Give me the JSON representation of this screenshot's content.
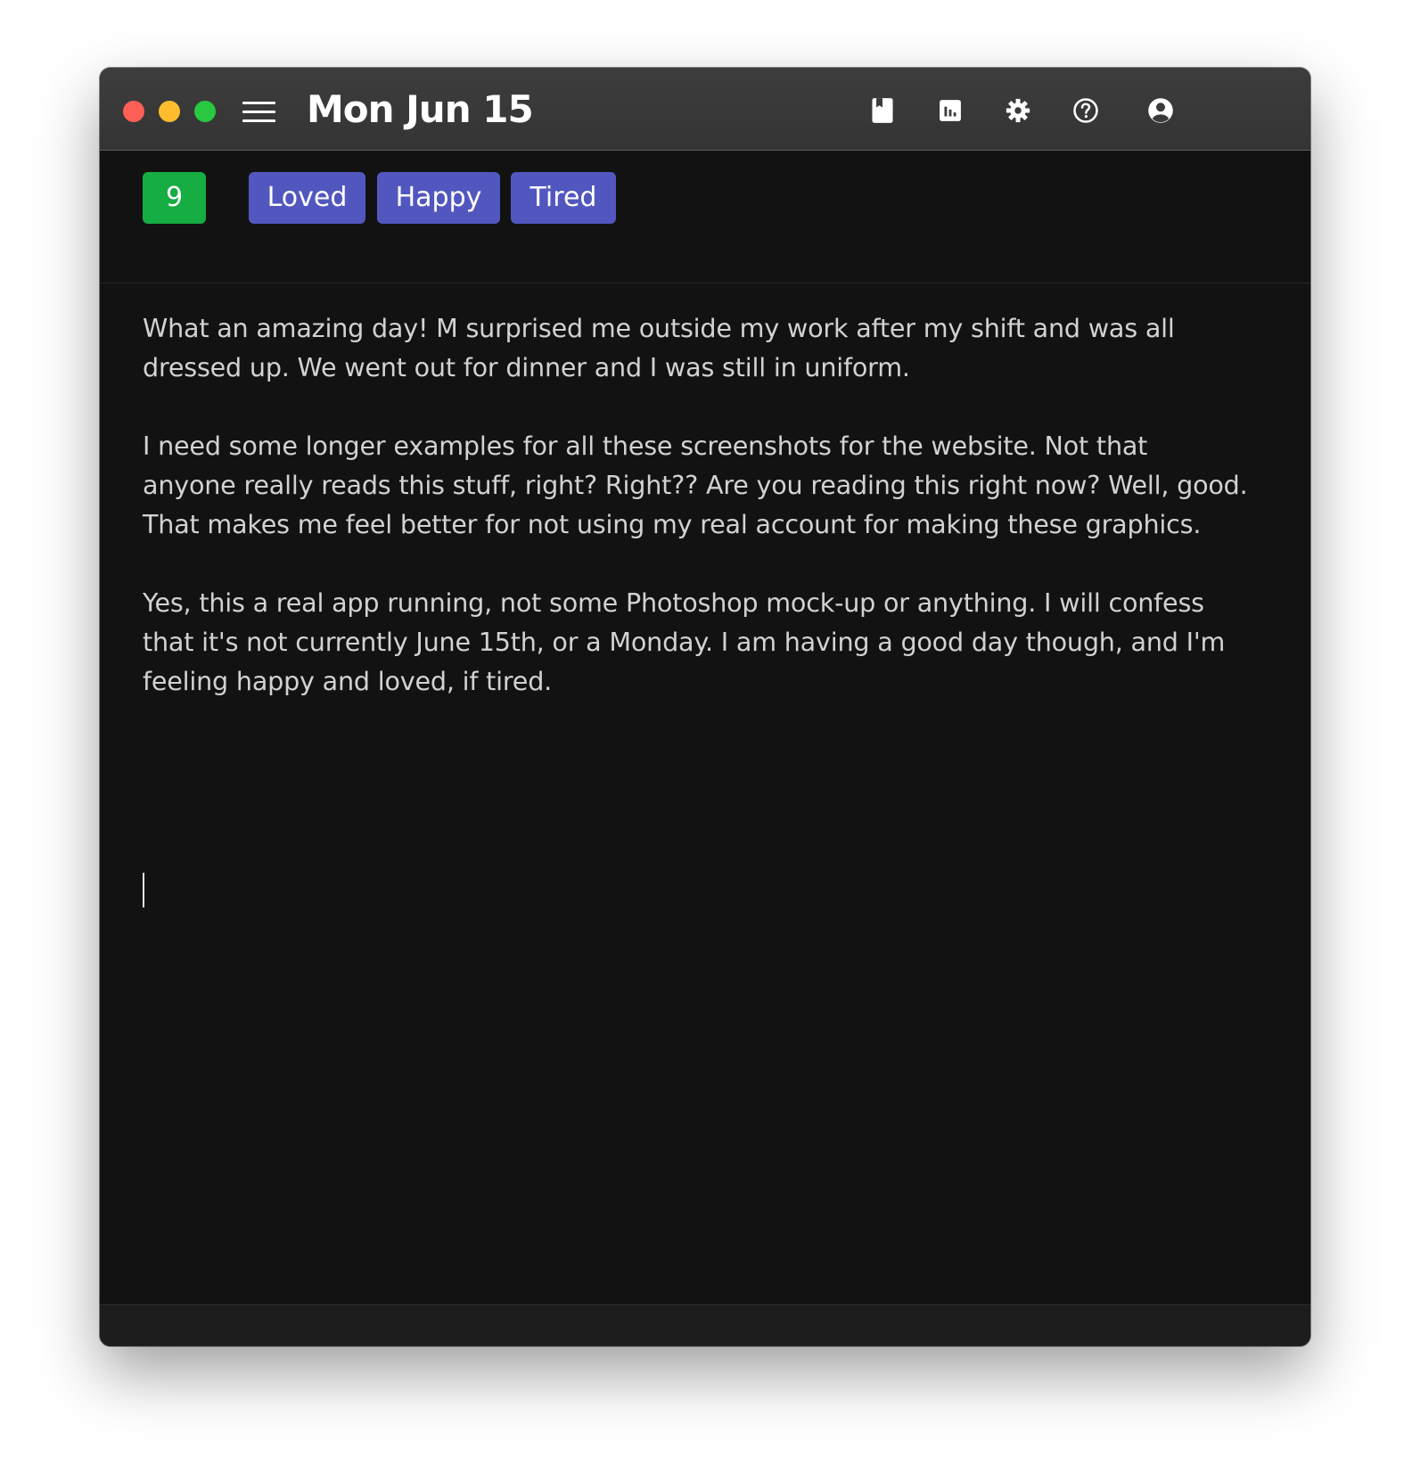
{
  "window": {
    "title": "Mon Jun 15"
  },
  "toolbar": {
    "icons": [
      "journal-icon",
      "stats-icon",
      "gear-icon",
      "help-icon",
      "account-icon"
    ]
  },
  "entry": {
    "score": "9",
    "tags": [
      "Loved",
      "Happy",
      "Tired"
    ],
    "paragraphs": [
      "What an amazing day! M surprised me outside my work after my shift and was all dressed up. We went out for dinner and I was still in uniform.",
      "I need some longer examples for all these screenshots for the website. Not that anyone really reads this stuff, right? Right?? Are you reading this right now? Well, good. That makes me feel better for not using my real account for making these graphics.",
      "Yes, this a real app running, not some Photoshop mock-up or anything. I will confess that it's not currently June 15th, or a Monday. I am having a good day though, and I'm feeling happy and loved, if tired."
    ]
  },
  "colors": {
    "titlebar": "#3a3a3a",
    "background": "#121212",
    "score_badge": "#16ad43",
    "tag_pill": "#5257c0",
    "text": "#d2d2d2"
  }
}
